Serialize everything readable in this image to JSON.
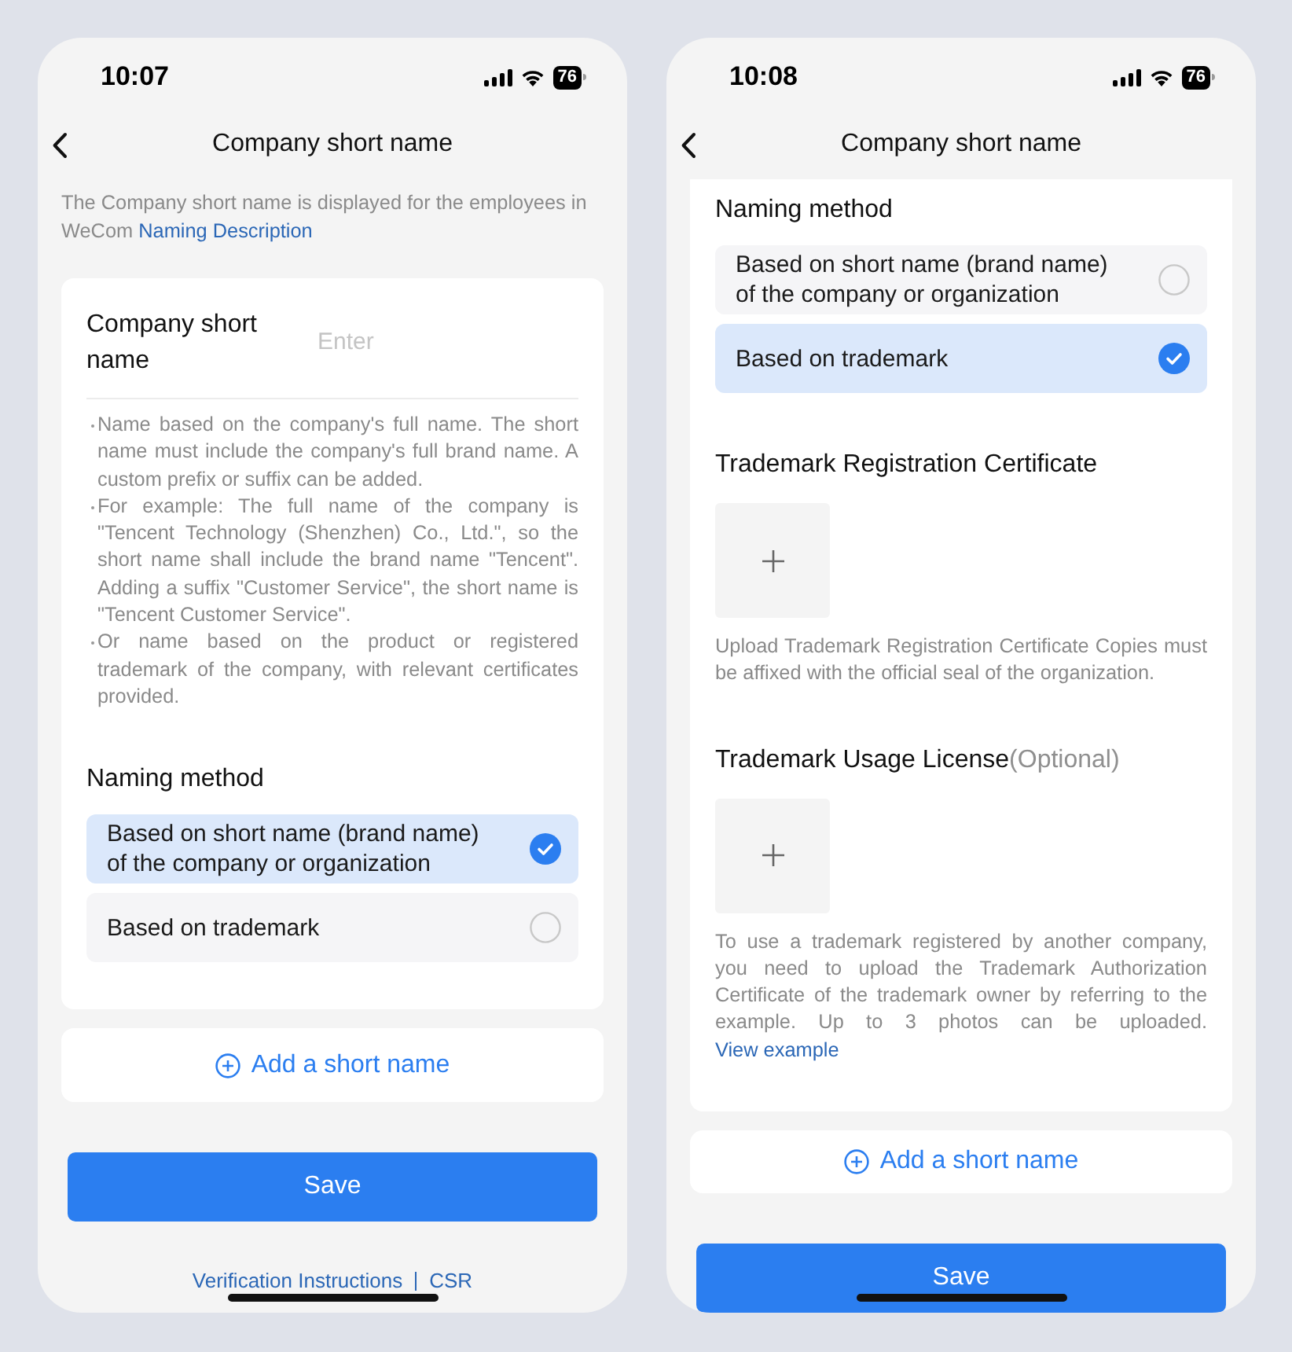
{
  "phones": [
    {
      "status_bar": {
        "time": "10:07",
        "battery": "76"
      },
      "title": "Company short name",
      "intro": {
        "text": "The Company short name is displayed for the employees in WeCom",
        "link": "Naming Description"
      },
      "card": [
        {
          "kind": "field",
          "label": "Company short name",
          "placeholder": "Enter"
        },
        {
          "kind": "bullets",
          "items": [
            "Name based on the company's full name. The short name must include the company's full brand name. A custom prefix or suffix can be added.",
            "For example: The full name of the company is \"Tencent Technology (Shenzhen) Co., Ltd.\", so the short name shall include the brand name \"Tencent\". Adding a suffix \"Customer Service\", the short name is \"Tencent Customer Service\".",
            "Or name based on the product or registered trademark of the company, with relevant certificates provided."
          ]
        },
        {
          "kind": "heading",
          "text": "Naming method"
        },
        {
          "kind": "options",
          "items": [
            {
              "label": "Based on short name (brand name) of the company or organization",
              "selected": true
            },
            {
              "label": "Based on trademark",
              "selected": false
            }
          ]
        }
      ],
      "add_button": "Add a short name",
      "save_button": "Save",
      "footer_links": [
        "Verification Instructions",
        "CSR"
      ]
    },
    {
      "status_bar": {
        "time": "10:08",
        "battery": "76"
      },
      "title": "Company short name",
      "card": [
        {
          "kind": "heading",
          "text": "Naming method"
        },
        {
          "kind": "options",
          "items": [
            {
              "label": "Based on short name (brand name) of the company or organization",
              "selected": false
            },
            {
              "label": "Based on trademark",
              "selected": true
            }
          ]
        },
        {
          "kind": "heading",
          "text": "Trademark Registration Certificate"
        },
        {
          "kind": "upload",
          "hint": "Upload Trademark Registration Certificate Copies must be affixed with the official seal of the organization."
        },
        {
          "kind": "heading",
          "text": "Trademark Usage License",
          "note": "(Optional)"
        },
        {
          "kind": "upload",
          "hint": "To use a trademark registered by another company, you need to upload the Trademark Authorization Certificate of the trademark owner by referring to the example. Up to 3 photos can be uploaded.",
          "link": "View example"
        }
      ],
      "add_button": "Add a short name",
      "save_button": "Save"
    }
  ]
}
